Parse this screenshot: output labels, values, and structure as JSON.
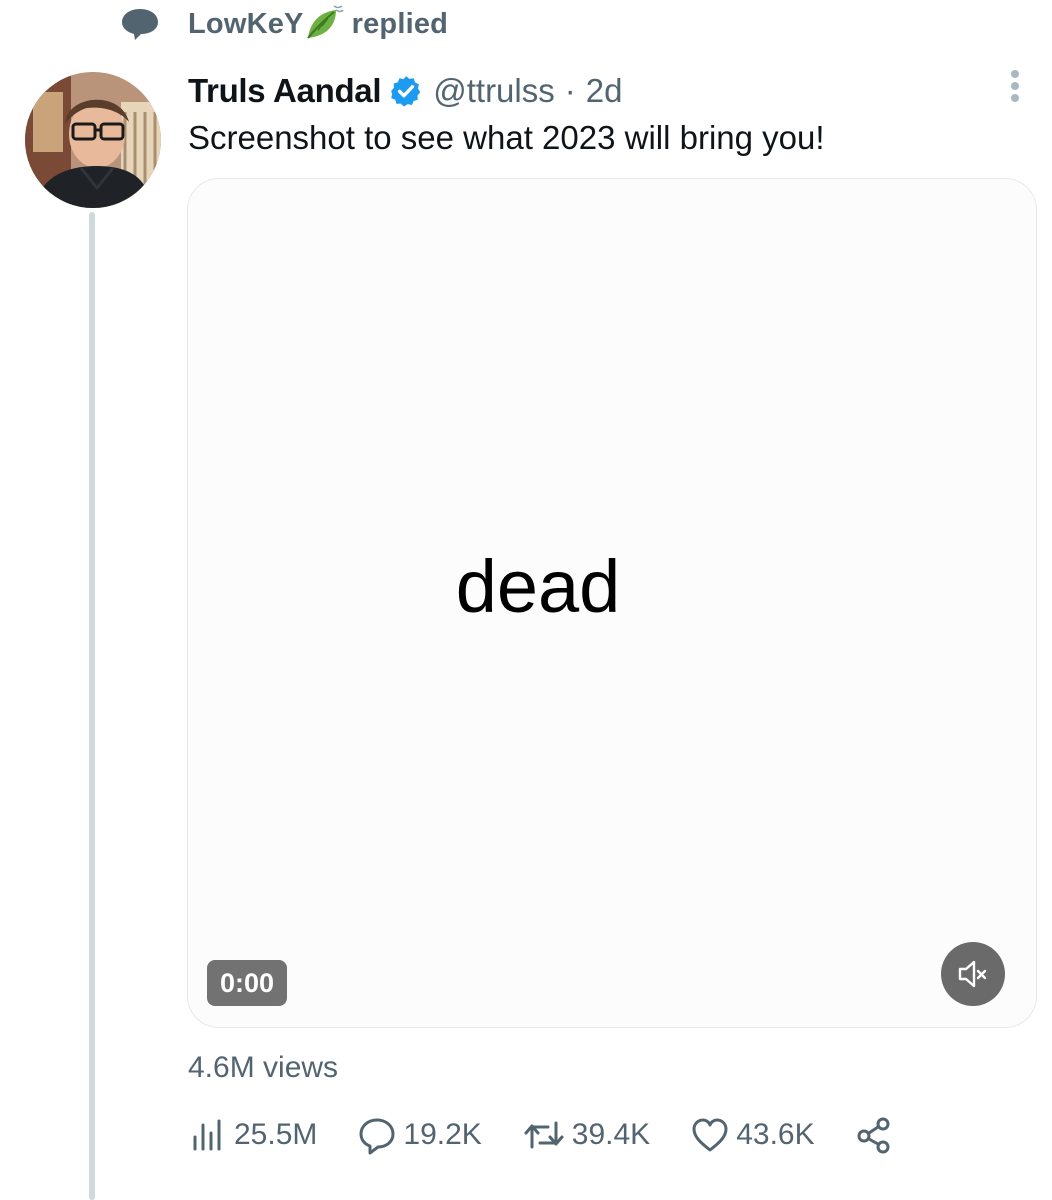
{
  "social_context": {
    "user": "LowKeY",
    "action": "replied",
    "icon": "speech-bubble-icon",
    "emoji": "leaf-fluttering-in-wind-emoji"
  },
  "tweet": {
    "display_name": "Truls Aandal",
    "verified": true,
    "handle": "@ttrulss",
    "separator": "·",
    "time": "2d",
    "text": "Screenshot to see what 2023 will bring you!",
    "media": {
      "type": "video",
      "word": "dead",
      "timestamp": "0:00",
      "muted": true
    },
    "views_line": "4.6M views",
    "actions": {
      "analytics": "25.5M",
      "replies": "19.2K",
      "retweets": "39.4K",
      "likes": "43.6K"
    }
  },
  "colors": {
    "text_primary": "#0f1419",
    "text_secondary": "#536471",
    "verified_blue": "#1d9bf0",
    "thread_line": "#cfd9de"
  }
}
